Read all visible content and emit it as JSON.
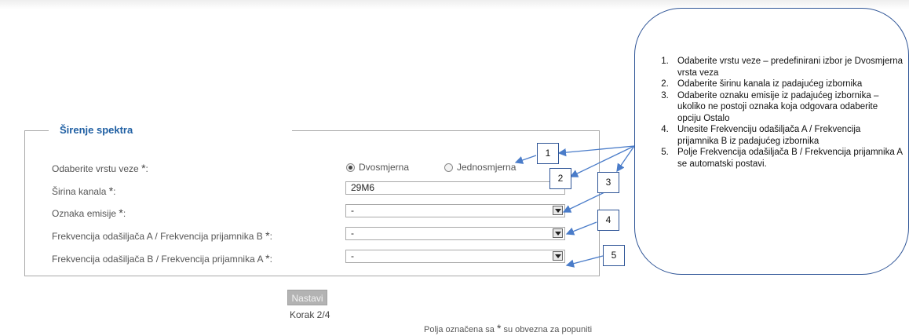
{
  "form": {
    "legend": "Širenje spektra",
    "star": "*",
    "colon": ":",
    "rows": [
      {
        "label": "Odaberite vrstu veze"
      },
      {
        "label": "Širina kanala"
      },
      {
        "label": "Oznaka emisije"
      },
      {
        "label": "Frekvencija odašiljača A / Frekvencija prijamnika B"
      },
      {
        "label": "Frekvencija odašiljača B / Frekvencija prijamnika A"
      }
    ],
    "radio_options": [
      "Dvosmjerna",
      "Jednosmjerna"
    ],
    "radio_selected": "Dvosmjerna",
    "sirina_value": "29M6",
    "oznaka_value": "-",
    "freq_ab_value": "-",
    "freq_ba_value": "-",
    "next_button": "Nastavi",
    "step": "Korak 2/4",
    "footer_prefix": "Polja označena sa",
    "footer_suffix": "su obvezna za popuniti"
  },
  "callout": {
    "items": [
      "Odaberite vrstu veze – predefinirani izbor je Dvosmjerna vrsta veza",
      "Odaberite širinu kanala iz padajućeg izbornika",
      "Odaberite oznaku emisije iz padajućeg izbornika – ukoliko ne postoji oznaka koja odgovara odaberite opciju Ostalo",
      "Unesite Frekvenciju odašiljača A / Frekvencija prijamnika B iz padajućeg izbornika",
      "Polje Frekvencija odašiljača B / Frekvencija prijamnika A se automatski postavi."
    ],
    "markers": [
      "1",
      "2",
      "3",
      "4",
      "5"
    ]
  },
  "colors": {
    "legend": "#1f5fa3",
    "callout_border": "#2f5597",
    "arrow": "#4a7cc9",
    "button_disabled": "#b3b3b3"
  }
}
